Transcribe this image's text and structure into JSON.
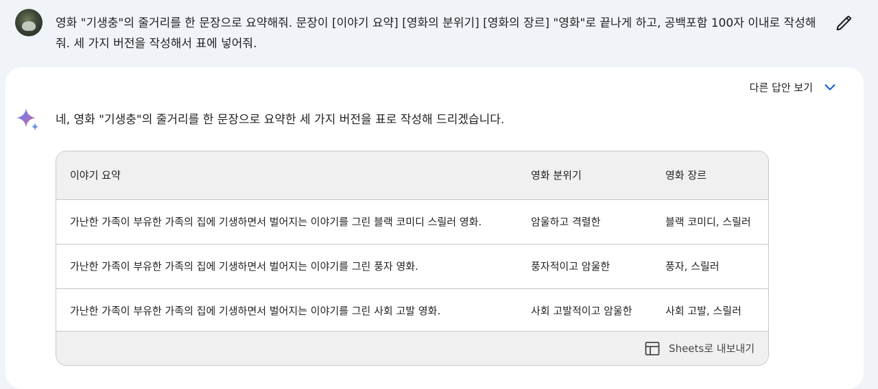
{
  "prompt": {
    "text": "영화 \"기생충\"의 줄거리를 한 문장으로 요약해줘. 문장이 [이야기 요약] [영화의 분위기] [영화의 장르] \"영화\"로 끝나게 하고, 공백포함 100자 이내로 작성해줘. 세 가지 버전을 작성해서 표에 넣어줘."
  },
  "response": {
    "drafts_label": "다른 답안 보기",
    "intro": "네, 영화 \"기생충\"의 줄거리를 한 문장으로 요약한 세 가지 버전을 표로 작성해 드리겠습니다.",
    "table": {
      "headers": [
        "이야기 요약",
        "영화 분위기",
        "영화 장르"
      ],
      "rows": [
        [
          "가난한 가족이 부유한 가족의 집에 기생하면서 벌어지는 이야기를 그린 블랙 코미디 스릴러 영화.",
          "암울하고 격렬한",
          "블랙 코미디, 스릴러"
        ],
        [
          "가난한 가족이 부유한 가족의 집에 기생하면서 벌어지는 이야기를 그린 풍자 영화.",
          "풍자적이고 암울한",
          "풍자, 스릴러"
        ],
        [
          "가난한 가족이 부유한 가족의 집에 기생하면서 벌어지는 이야기를 그린 사회 고발 영화.",
          "사회 고발적이고 암울한",
          "사회 고발, 스릴러"
        ]
      ],
      "export_label": "Sheets로 내보내기"
    }
  },
  "icons": {
    "edit": "pencil-icon",
    "drafts": "chevron-down-icon",
    "assistant": "sparkle-icon",
    "export": "table-icon"
  },
  "colors": {
    "page_bg": "#f0f4f9",
    "card_bg": "#ffffff",
    "chevron": "#0b57d0",
    "table_header_bg": "#f0f0f0"
  }
}
